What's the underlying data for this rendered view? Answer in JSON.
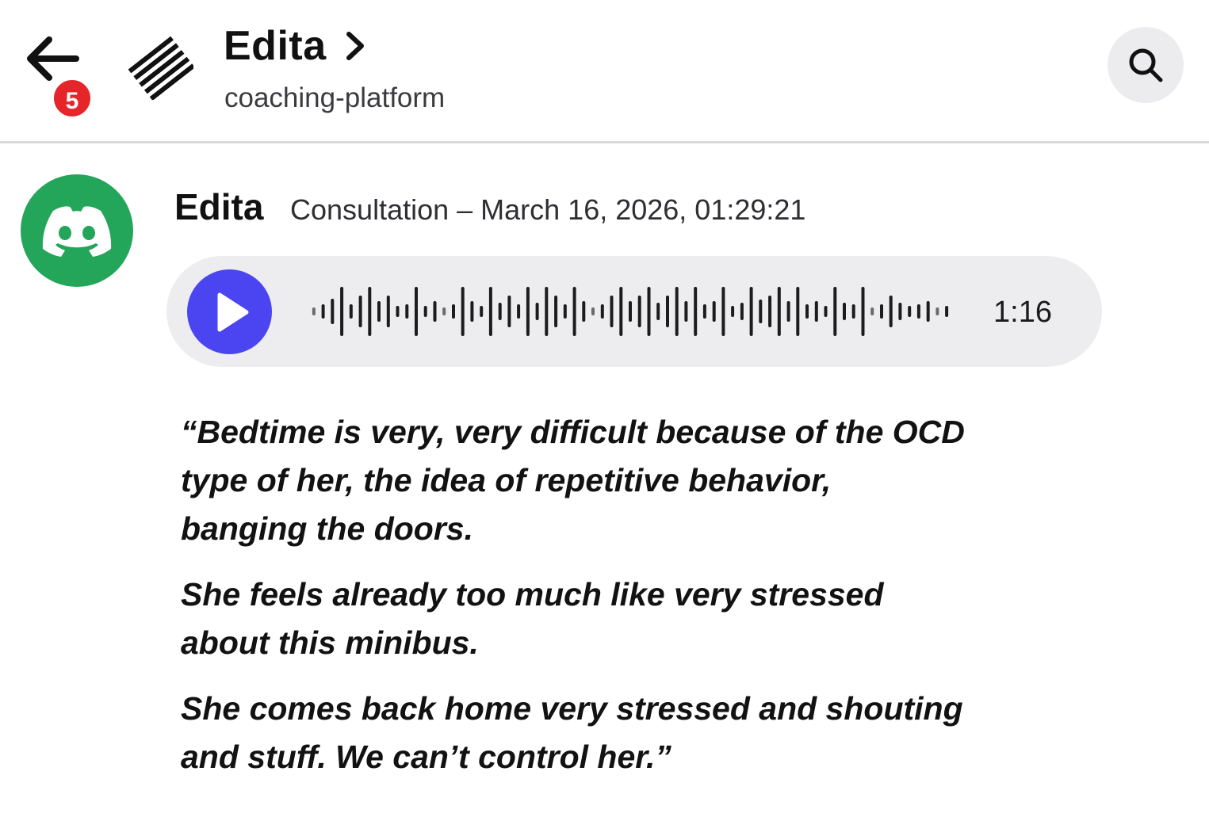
{
  "header": {
    "back_badge": "5",
    "title": "Edita",
    "subtitle": "coaching-platform",
    "icons": {
      "back": "arrow-left-icon",
      "channel": "striped-channel-icon",
      "title_chevron": "chevron-right-icon",
      "search": "search-icon"
    }
  },
  "message": {
    "author": "Edita",
    "timestamp": "Consultation – March 16, 2026, 01:29:21",
    "avatar_icon": "discord-logo-icon",
    "voice": {
      "duration": "1:16",
      "play_icon": "play-icon"
    },
    "transcript": [
      "“Bedtime is very, very difficult because of the OCD\ntype of her, the idea of repetitive behavior,\nbanging the doors.",
      "She feels already too much like very stressed\nabout this minibus.",
      "She comes back home very stressed and shouting\nand stuff. We can’t control her.”"
    ]
  },
  "colors": {
    "badge": "#e5252a",
    "avatar": "#23a55a",
    "play_button": "#4a45f0",
    "voice_bubble": "#ededef",
    "search_button_bg": "#ececee"
  }
}
